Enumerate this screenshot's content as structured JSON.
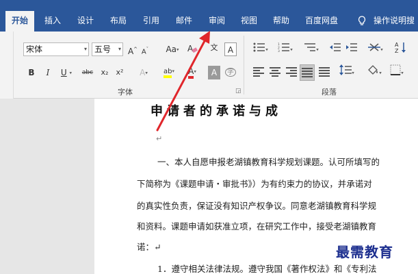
{
  "ribbon_tabs": [
    {
      "label": "开始"
    },
    {
      "label": "插入"
    },
    {
      "label": "设计"
    },
    {
      "label": "布局"
    },
    {
      "label": "引用"
    },
    {
      "label": "邮件"
    },
    {
      "label": "审阅"
    },
    {
      "label": "视图"
    },
    {
      "label": "帮助"
    },
    {
      "label": "百度网盘"
    },
    {
      "label": "操作说明搜"
    }
  ],
  "font_group": {
    "font_name": "宋体",
    "font_size": "五号",
    "grow_font": "A",
    "shrink_font": "A",
    "change_case": "Aa",
    "phonetic": "文",
    "char_border": "A",
    "bold": "B",
    "italic": "I",
    "underline": "U",
    "strikethrough": "abc",
    "subscript": "x₂",
    "superscript": "x²",
    "text_effects": "A",
    "highlight": "ab",
    "font_color": "A",
    "char_shading": "A",
    "enclose": "字",
    "label": "字体"
  },
  "paragraph_group": {
    "label": "段落"
  },
  "document": {
    "title": "申请者的承诺与成",
    "para_mark": "↵",
    "lines": [
      "一、本人自愿申报老湖镇教育科学规划课题。认可所填写的",
      "下简称为《课题申请・审批书》）为有约束力的协议，并承诺对",
      "的真实性负责，保证没有知识产权争议。同意老湖镇教育科学规",
      "和资料。课题申请如获准立项，在研究工作中，接受老湖镇教育",
      "诺：↵",
      "1．遵守相关法律法规。遵守我国《著作权法》和《专利法"
    ]
  },
  "watermark": "最需教育",
  "colors": {
    "ribbon_blue": "#2b579a",
    "arrow_red": "#e0262b",
    "watermark": "#1d2f8f"
  }
}
